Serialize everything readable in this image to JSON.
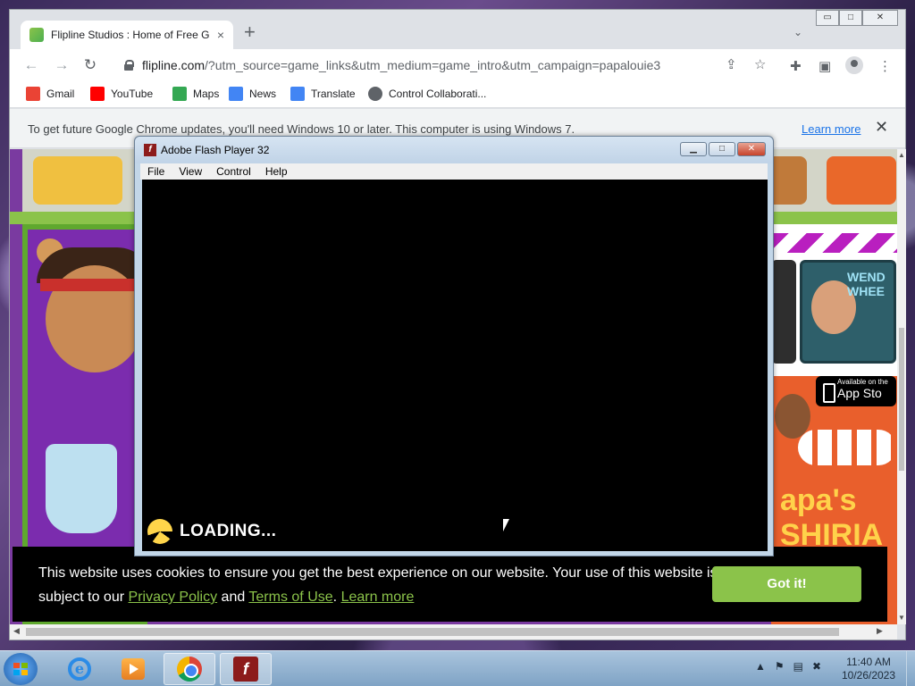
{
  "browser": {
    "tab_title": "Flipline Studios : Home of Free G",
    "tab_close": "×",
    "new_tab": "+",
    "tab_search": "⌄",
    "url_host": "flipline.com",
    "url_rest": "/?utm_source=game_links&utm_medium=game_intro&utm_campaign=papalouie3",
    "window_controls": {
      "minimize": "▭",
      "maximize": "□",
      "close": "✕"
    }
  },
  "bookmarks": [
    {
      "label": "Gmail",
      "color": "#ea4335"
    },
    {
      "label": "YouTube",
      "color": "#ff0000"
    },
    {
      "label": "Maps",
      "color": "#34a853"
    },
    {
      "label": "News",
      "color": "#4285f4"
    },
    {
      "label": "Translate",
      "color": "#4285f4"
    },
    {
      "label": "Control Collaborati...",
      "color": "#5f6368"
    }
  ],
  "infobar": {
    "message": "To get future Google Chrome updates, you'll need Windows 10 or later. This computer is using Windows 7.",
    "learn_more": "Learn more",
    "close": "✕"
  },
  "page": {
    "rt_title": "WEND WHEE",
    "app_store_small": "Available on the",
    "app_store_big": "App Sto",
    "papas": "apa's SHIRIA"
  },
  "cookie": {
    "text_1": "This website uses cookies to ensure you get the best experience on our website. Your use of this website is subject to our",
    "privacy": "Privacy Policy",
    "and": "and",
    "terms": "Terms of Use",
    "dot": ".",
    "learn_more": "Learn more",
    "button": "Got it!"
  },
  "flash": {
    "title": "Adobe Flash Player 32",
    "logo": "f",
    "menu": [
      "File",
      "View",
      "Control",
      "Help"
    ],
    "loading": "LOADING..."
  },
  "taskbar": {
    "time": "11:40 AM",
    "date": "10/26/2023"
  },
  "colors": {
    "accent_green": "#8bc34a",
    "flash_red": "#8c1b1b"
  }
}
